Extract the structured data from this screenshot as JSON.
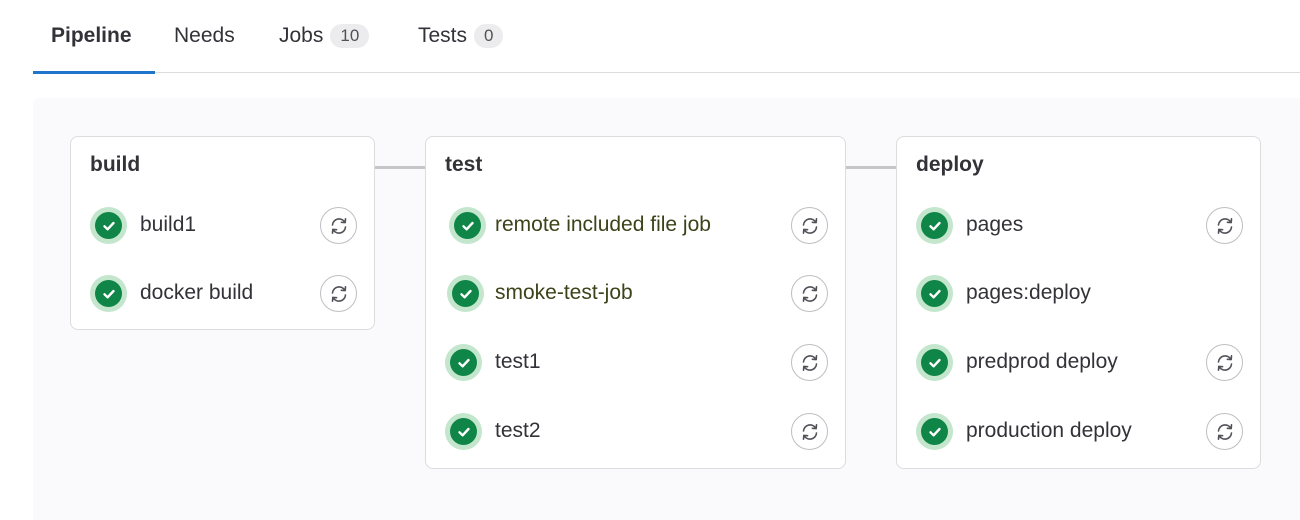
{
  "tabs": [
    {
      "label": "Pipeline",
      "active": true
    },
    {
      "label": "Needs",
      "active": false
    },
    {
      "label": "Jobs",
      "count": "10",
      "active": false
    },
    {
      "label": "Tests",
      "count": "0",
      "active": false
    }
  ],
  "colors": {
    "active_tab_underline": "#1f75cb",
    "success": "#108548",
    "success_ring": "#c3e6cd",
    "graph_background": "#fafafc"
  },
  "stages": [
    {
      "name": "build",
      "jobs": [
        {
          "name": "build1",
          "status": "success",
          "icon": "check-circle-icon",
          "action": "retry-icon"
        },
        {
          "name": "docker build",
          "status": "success",
          "icon": "check-circle-icon",
          "action": "retry-icon"
        }
      ]
    },
    {
      "name": "test",
      "jobs": [
        {
          "name": "remote included file job",
          "status": "success",
          "icon": "check-circle-icon",
          "action": "retry-icon"
        },
        {
          "name": "smoke-test-job",
          "status": "success",
          "icon": "check-circle-icon",
          "action": "retry-icon"
        },
        {
          "name": "test1",
          "status": "success",
          "icon": "check-circle-icon",
          "action": "retry-icon"
        },
        {
          "name": "test2",
          "status": "success",
          "icon": "check-circle-icon",
          "action": "retry-icon"
        }
      ]
    },
    {
      "name": "deploy",
      "jobs": [
        {
          "name": "pages",
          "status": "success",
          "icon": "check-circle-icon",
          "action": "retry-icon"
        },
        {
          "name": "pages:deploy",
          "status": "success",
          "icon": "check-circle-icon",
          "action": null
        },
        {
          "name": "predprod deploy",
          "status": "success",
          "icon": "check-circle-icon",
          "action": "retry-icon"
        },
        {
          "name": "production deploy",
          "status": "success",
          "icon": "check-circle-icon",
          "action": "retry-icon"
        }
      ]
    }
  ]
}
